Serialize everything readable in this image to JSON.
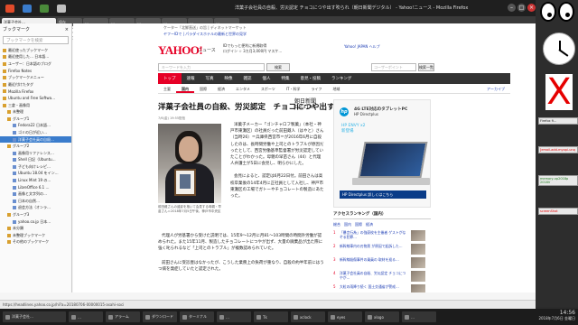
{
  "window": {
    "title": "洋菓子会社員の自殺、労災認定 チョコにつや出す吹られ（朝日新聞デジタル） - Yahoo!ニュース - Mozilla Firefox"
  },
  "browser": {
    "tabs": [
      "洋菓子会社…",
      "保存",
      "…",
      "…",
      "…",
      "…",
      "…",
      "…"
    ],
    "url": "https://headlines.yahoo.co.jp/hl?a=20180706-00000015-asahi-soci",
    "search_placeholder": "検索"
  },
  "sidebar": {
    "title": "ブックマーク",
    "close_glyph": "×",
    "search_placeholder": "ブックマークを検索",
    "items": [
      {
        "label": "最近使ったブックマーク",
        "kind": "folder"
      },
      {
        "label": "最近使用した… 日本語…",
        "kind": "folder"
      },
      {
        "label": "ユーザー：日本語のブログ",
        "kind": "folder"
      },
      {
        "label": "Firefox Notes",
        "kind": "folder"
      },
      {
        "label": "ブックマークメニュー",
        "kind": "folder"
      },
      {
        "label": "最近付けたタグ",
        "kind": "folder"
      },
      {
        "label": "Mozilla Firefox",
        "kind": "folder"
      },
      {
        "label": "Ubuntu and Free Softwa…",
        "kind": "folder"
      },
      {
        "label": "三倉・画像用",
        "kind": "folder"
      },
      {
        "label": "未整理",
        "kind": "folder"
      },
      {
        "label": "グループ1",
        "kind": "folder"
      },
      {
        "label": "Fedora22 日本語…",
        "kind": "page"
      },
      {
        "label": "ゴミの日が近い…",
        "kind": "page"
      },
      {
        "label": "洋菓子会社員の自殺…",
        "kind": "page",
        "selected": true
      },
      {
        "label": "グループ2",
        "kind": "folder"
      },
      {
        "label": "画像用リファレンス…",
        "kind": "page"
      },
      {
        "label": "Shell 日記（Ubuntu…",
        "kind": "page"
      },
      {
        "label": "子ども向けレシピ…",
        "kind": "page"
      },
      {
        "label": "Ubuntu 18.04 をイン…",
        "kind": "page"
      },
      {
        "label": "Linux Mint 19 の…",
        "kind": "page"
      },
      {
        "label": "LibreOffice 6.1 …",
        "kind": "page"
      },
      {
        "label": "画像と文字列の…",
        "kind": "page"
      },
      {
        "label": "日本の自然…",
        "kind": "page"
      },
      {
        "label": "退会方法（オンラ…",
        "kind": "page"
      },
      {
        "label": "グループ3",
        "kind": "folder"
      },
      {
        "label": "yahoo.co.jp 日本…",
        "kind": "page"
      },
      {
        "label": "未分類",
        "kind": "folder"
      },
      {
        "label": "未整理ブックマーク",
        "kind": "folder"
      },
      {
        "label": "その他のブックマーク",
        "kind": "folder"
      }
    ]
  },
  "page": {
    "ad_line1": "ケーター「北鮮直送」の旨 | ディネットマーケット",
    "ad_line2": "ヤフーIDで | パラダイスホテルの最新と世界の見学",
    "logo": "YAHOO!",
    "logo_sub": "JAPAN",
    "news_label": "ニュース",
    "news_notice": "IDでもっと便利に新規取得\nログイン ☆ 3カ月3,000円 マスケ…",
    "top_links": "Yahoo! JAPAN  ヘルプ",
    "search_placeholder": "キーワードを入力",
    "search_button": "検索",
    "keyword_label": "コーザーポイント",
    "keyword_button": "検索一覧",
    "nav": [
      "トップ",
      "速報",
      "写真",
      "映像",
      "雑誌",
      "個人",
      "特集",
      "意見・投稿",
      "ランキング"
    ],
    "nav_active": 0,
    "subnav": [
      "主要",
      "国内",
      "国際",
      "経済",
      "エンタメ",
      "スポーツ",
      "IT・科学",
      "ライフ",
      "地域"
    ],
    "subnav_active": 1,
    "archive": "アーカイブ",
    "headline": "洋菓子会社員の自殺、労災認定　チョコにつや出す吹られ",
    "source_logo": "朝日新聞\nDIGITAL",
    "dateline": "7/6(金) 19:55配信",
    "photo_caption": "前田蔵さんの遺影を抱いて会見する母親・早苗さん＝2018年7月5日午後、神戸市中央区",
    "paragraphs_narrow": [
      "洋菓子メーカー「ゴンチャロフ製菓」（本社・神戸市東灘区）の社員だった前田蔵人（はやと）さん（当時26）＝兵庫県西宮市＝が2016年6月に自殺したのは、長時間労働や上司とのトラブルが原因だったとして、西宮労働基準監督署が労災認定していたことがわかった。母親の早苗さん（44）と代理人弁護士が5日に会見し、明らかにした。",
      "会見によると、認定は6月22日付。前田さんは高校卒業後の14年4月に正社員として入社し、神戸市東灘区の工場でガトーやチョコレートの製造にあたった。"
    ],
    "paragraphs_wide": [
      "代理人が労基署から受けた説明では、15年9～12月に月81～103時間の時間外労働が認められた。また15年11月、製造したチョコレートにつやが出ず、大量の廃棄品が出た際に強く叱られるなど「上司とのトラブル」が複数認められていた。",
      "前田さんに受診歴はなかったが、こうした業務上の負荷が重なり、自殺の約半年前にはうつ病を発症していたと認定された。"
    ],
    "ad": {
      "brand": "hp",
      "line1": "4G LTE対応のタブレットPC",
      "line2": "HP Directplus",
      "model": "HP ENVY x2\n新登場",
      "footer": "HP Directplus  詳しくはこちら"
    },
    "ranking": {
      "title": "アクセスランキング（国内）",
      "tabs": [
        "総合",
        "国内",
        "国際",
        "経済"
      ],
      "items": [
        {
          "rank": "1",
          "text": "「暴言行為」の強豪校を主催者 ゲストがなぞる犯罪…"
        },
        {
          "rank": "2",
          "text": "新幹線車内の刃物男 が原因で起訴した…"
        },
        {
          "rank": "3",
          "text": "新幹線殺傷事件の乗員の 取材を巡る…"
        },
        {
          "rank": "4",
          "text": "洋菓子会社員の自殺、労災認定 チョコにつやが…"
        },
        {
          "rank": "5",
          "text": "大粒の雨降り続く 国土交通省が警戒…"
        },
        {
          "rank": "6",
          "text": "自転車事故、女性の賠償金2億…"
        },
        {
          "rank": "7",
          "text": "大雨の被害予想 ＜交通アクセス＞…"
        }
      ]
    }
  },
  "statusbar": {
    "text": "https://headlines.yahoo.co.jp/hl?a=20180706-00000015-asahi-soci"
  },
  "taskbar": {
    "tasks": [
      "洋菓子会社…",
      "…",
      "アラーム",
      "ダウンロード",
      "ターミナル",
      "…",
      "Tk",
      "xclock",
      "eyes",
      "xlogo",
      "…"
    ],
    "time": "14:56",
    "date": "2018年7月6日 金曜日"
  },
  "desktop": {
    "widgets": [
      {
        "text": "Firefox fi…",
        "tone": "normal"
      },
      {
        "text": "[email-add-myopi-unq",
        "tone": "red"
      },
      {
        "text": "memory-xp2018p 2018V",
        "tone": "green"
      },
      {
        "text": "screenShot",
        "tone": "red"
      }
    ],
    "x_glyph": "X"
  },
  "colors": {
    "yahoo_red": "#e60026",
    "link_blue": "#1a3bb3",
    "selection_blue": "#3a7ccc",
    "hp_blue": "#0096d6"
  }
}
